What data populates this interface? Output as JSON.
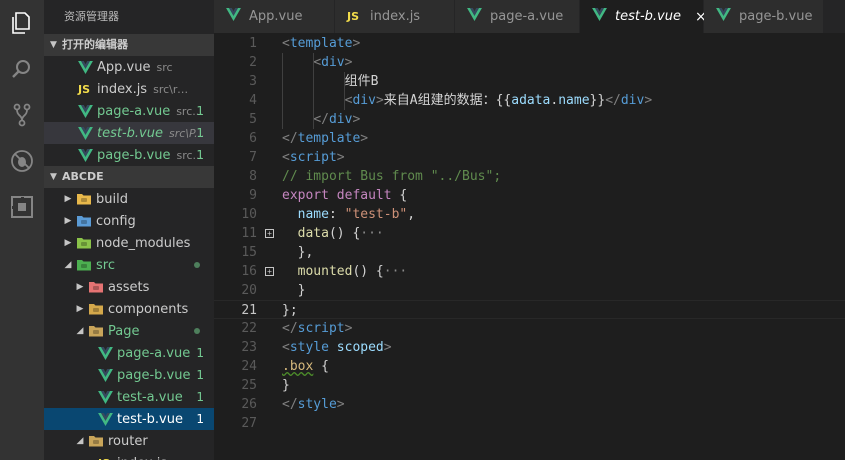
{
  "sidebar": {
    "title": "资源管理器",
    "open_editors_header": "打开的编辑器",
    "open_editors": [
      {
        "icon": "vue",
        "name": "App.vue",
        "path": "src",
        "badge": "",
        "modified": false,
        "italic": false
      },
      {
        "icon": "js",
        "name": "index.js",
        "path": "src\\router",
        "badge": "",
        "modified": false,
        "italic": false
      },
      {
        "icon": "vue",
        "name": "page-a.vue",
        "path": "src...",
        "badge": "1",
        "modified": true,
        "italic": false
      },
      {
        "icon": "vue",
        "name": "test-b.vue",
        "path": "src\\P...",
        "badge": "1",
        "modified": true,
        "italic": true
      },
      {
        "icon": "vue",
        "name": "page-b.vue",
        "path": "src...",
        "badge": "1",
        "modified": true,
        "italic": false
      }
    ],
    "project_header": "ABCDE",
    "tree": [
      {
        "name": "build",
        "icon": "folder-build",
        "depth": 0,
        "expanded": false,
        "modified": false
      },
      {
        "name": "config",
        "icon": "folder-config",
        "depth": 0,
        "expanded": false,
        "modified": false
      },
      {
        "name": "node_modules",
        "icon": "folder-node",
        "depth": 0,
        "expanded": false,
        "modified": false
      },
      {
        "name": "src",
        "icon": "folder-src",
        "depth": 0,
        "expanded": true,
        "modified": true
      },
      {
        "name": "assets",
        "icon": "folder-assets",
        "depth": 1,
        "expanded": false,
        "modified": false
      },
      {
        "name": "components",
        "icon": "folder-components",
        "depth": 1,
        "expanded": false,
        "modified": false
      },
      {
        "name": "Page",
        "icon": "folder-open",
        "depth": 1,
        "expanded": true,
        "modified": true
      },
      {
        "name": "page-a.vue",
        "icon": "vue",
        "depth": 2,
        "badge": "1",
        "modified": true
      },
      {
        "name": "page-b.vue",
        "icon": "vue",
        "depth": 2,
        "badge": "1",
        "modified": true
      },
      {
        "name": "test-a.vue",
        "icon": "vue",
        "depth": 2,
        "badge": "1",
        "modified": true
      },
      {
        "name": "test-b.vue",
        "icon": "vue",
        "depth": 2,
        "badge": "1",
        "modified": true,
        "selected": true
      },
      {
        "name": "router",
        "icon": "folder-open",
        "depth": 1,
        "expanded": true,
        "modified": false
      },
      {
        "name": "index.js",
        "icon": "js",
        "depth": 2,
        "modified": false
      }
    ]
  },
  "tabs": [
    {
      "icon": "vue",
      "label": "App.vue",
      "active": false
    },
    {
      "icon": "js",
      "label": "index.js",
      "active": false
    },
    {
      "icon": "vue",
      "label": "page-a.vue",
      "active": false
    },
    {
      "icon": "vue",
      "label": "test-b.vue",
      "active": true,
      "close": "×"
    },
    {
      "icon": "vue",
      "label": "page-b.vue",
      "active": false
    }
  ],
  "editor": {
    "current_line": 21,
    "lines": [
      {
        "n": "1",
        "indent": 0,
        "tokens": [
          [
            "tk-br",
            "<"
          ],
          [
            "tk-tag",
            "template"
          ],
          [
            "tk-br",
            ">"
          ]
        ]
      },
      {
        "n": "2",
        "indent": 2,
        "tokens": [
          [
            "tk-br",
            "<"
          ],
          [
            "tk-tag",
            "div"
          ],
          [
            "tk-br",
            ">"
          ]
        ]
      },
      {
        "n": "3",
        "indent": 4,
        "tokens": [
          [
            "tk-txt",
            "组件B"
          ]
        ]
      },
      {
        "n": "4",
        "indent": 4,
        "tokens": [
          [
            "tk-br",
            "<"
          ],
          [
            "tk-tag",
            "div"
          ],
          [
            "tk-br",
            ">"
          ],
          [
            "tk-txt",
            "来自A组建的数据："
          ],
          [
            "tk-txt",
            "{{"
          ],
          [
            "tk-var",
            "adata"
          ],
          [
            "tk-txt",
            "."
          ],
          [
            "tk-var",
            "name"
          ],
          [
            "tk-txt",
            "}}"
          ],
          [
            "tk-br",
            "</"
          ],
          [
            "tk-tag",
            "div"
          ],
          [
            "tk-br",
            ">"
          ]
        ]
      },
      {
        "n": "5",
        "indent": 2,
        "tokens": [
          [
            "tk-br",
            "</"
          ],
          [
            "tk-tag",
            "div"
          ],
          [
            "tk-br",
            ">"
          ]
        ]
      },
      {
        "n": "6",
        "indent": 0,
        "tokens": [
          [
            "tk-br",
            "</"
          ],
          [
            "tk-tag",
            "template"
          ],
          [
            "tk-br",
            ">"
          ]
        ]
      },
      {
        "n": "7",
        "indent": 0,
        "tokens": [
          [
            "tk-br",
            "<"
          ],
          [
            "tk-tag",
            "script"
          ],
          [
            "tk-br",
            ">"
          ]
        ]
      },
      {
        "n": "8",
        "indent": 0,
        "tokens": [
          [
            "tk-com",
            "// import Bus from \"../Bus\";"
          ]
        ]
      },
      {
        "n": "9",
        "indent": 0,
        "tokens": [
          [
            "tk-kw",
            "export"
          ],
          [
            "tk-txt",
            " "
          ],
          [
            "tk-kw",
            "default"
          ],
          [
            "tk-txt",
            " {"
          ]
        ]
      },
      {
        "n": "10",
        "indent": 1,
        "tokens": [
          [
            "tk-var",
            "name"
          ],
          [
            "tk-txt",
            ": "
          ],
          [
            "tk-str",
            "\"test-b\""
          ],
          [
            "tk-txt",
            ","
          ]
        ]
      },
      {
        "n": "11",
        "indent": 1,
        "fold": true,
        "tokens": [
          [
            "tk-fn",
            "data"
          ],
          [
            "tk-txt",
            "() {"
          ],
          [
            "tk-fold",
            "···"
          ]
        ]
      },
      {
        "n": "15",
        "indent": 1,
        "tokens": [
          [
            "tk-txt",
            "},"
          ]
        ]
      },
      {
        "n": "16",
        "indent": 1,
        "fold": true,
        "tokens": [
          [
            "tk-fn",
            "mounted"
          ],
          [
            "tk-txt",
            "() {"
          ],
          [
            "tk-fold",
            "···"
          ]
        ]
      },
      {
        "n": "20",
        "indent": 1,
        "tokens": [
          [
            "tk-txt",
            "}"
          ]
        ]
      },
      {
        "n": "21",
        "indent": 0,
        "tokens": [
          [
            "tk-txt",
            "};"
          ]
        ]
      },
      {
        "n": "22",
        "indent": 0,
        "tokens": [
          [
            "tk-br",
            "</"
          ],
          [
            "tk-tag",
            "script"
          ],
          [
            "tk-br",
            ">"
          ]
        ]
      },
      {
        "n": "23",
        "indent": 0,
        "tokens": [
          [
            "tk-br",
            "<"
          ],
          [
            "tk-tag",
            "style"
          ],
          [
            "tk-txt",
            " "
          ],
          [
            "tk-var",
            "scoped"
          ],
          [
            "tk-br",
            ">"
          ]
        ]
      },
      {
        "n": "24",
        "indent": 0,
        "tokens": [
          [
            "tk-cls squig",
            ".box"
          ],
          [
            "tk-txt",
            " {"
          ]
        ]
      },
      {
        "n": "25",
        "indent": 0,
        "tokens": [
          [
            "tk-txt",
            "}"
          ]
        ]
      },
      {
        "n": "26",
        "indent": 0,
        "tokens": [
          [
            "tk-br",
            "</"
          ],
          [
            "tk-tag",
            "style"
          ],
          [
            "tk-br",
            ">"
          ]
        ]
      },
      {
        "n": "27",
        "indent": 0,
        "tokens": []
      }
    ]
  },
  "colors": {
    "vue_green": "#41b883",
    "vue_dark": "#35495e",
    "js_yellow": "#f2dc4b",
    "modified_green": "#73c991",
    "selection_blue": "#094771"
  }
}
